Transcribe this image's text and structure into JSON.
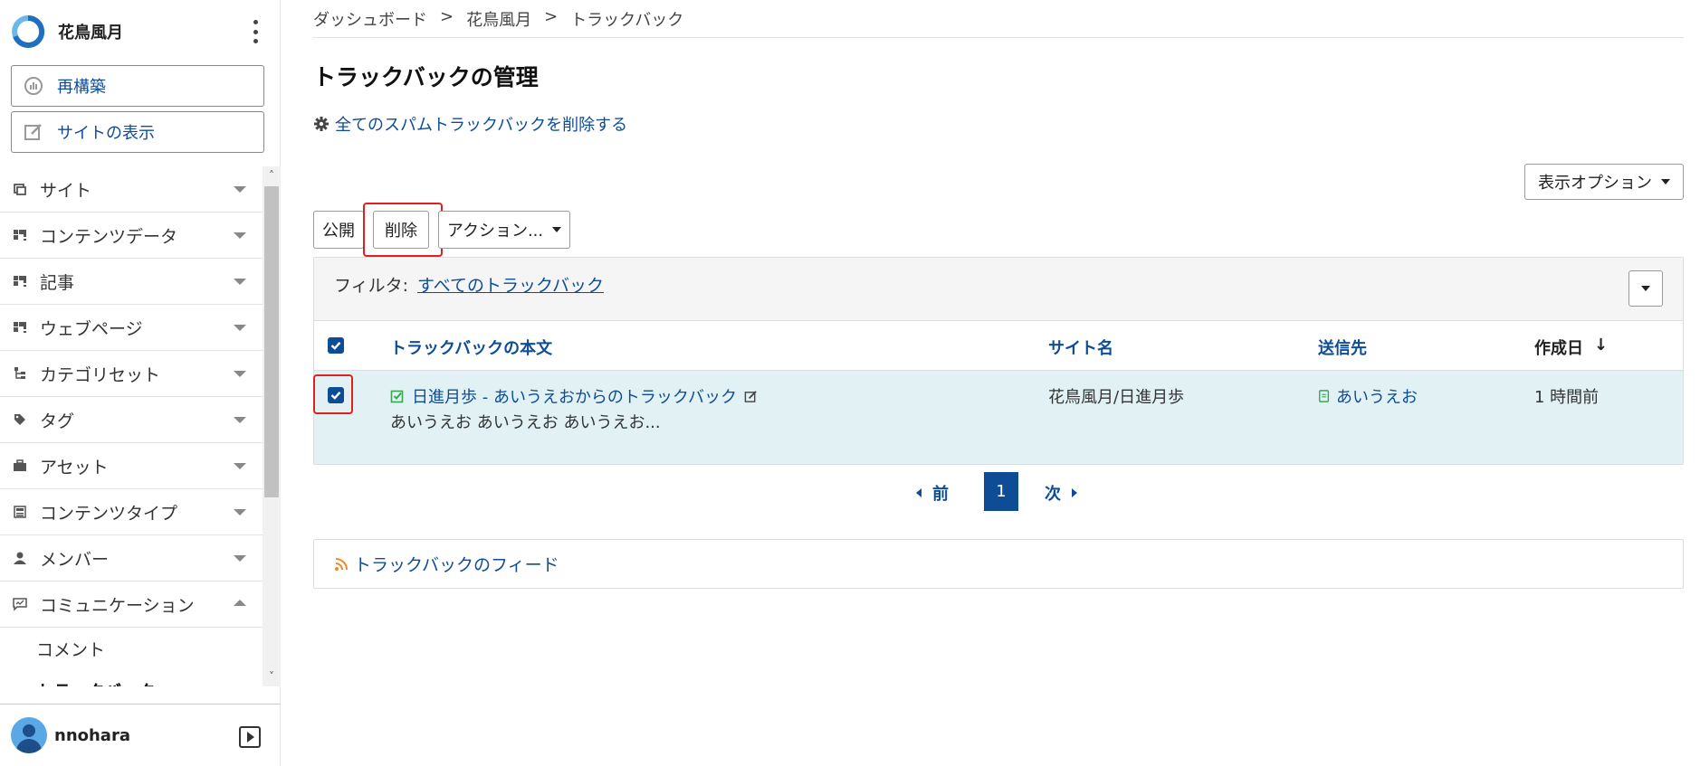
{
  "site": {
    "name": "花鳥風月"
  },
  "sidebar": {
    "buttons": {
      "rebuild": "再構築",
      "view_site": "サイトの表示"
    },
    "menu": [
      {
        "label": "サイト",
        "icon": "site-icon"
      },
      {
        "label": "コンテンツデータ",
        "icon": "content-data-icon"
      },
      {
        "label": "記事",
        "icon": "entry-icon"
      },
      {
        "label": "ウェブページ",
        "icon": "webpage-icon"
      },
      {
        "label": "カテゴリセット",
        "icon": "category-set-icon"
      },
      {
        "label": "タグ",
        "icon": "tag-icon"
      },
      {
        "label": "アセット",
        "icon": "asset-icon"
      },
      {
        "label": "コンテンツタイプ",
        "icon": "content-type-icon"
      },
      {
        "label": "メンバー",
        "icon": "member-icon"
      },
      {
        "label": "コミュニケーション",
        "icon": "communication-icon",
        "expanded": true
      }
    ],
    "submenu": [
      {
        "label": "コメント"
      },
      {
        "label": "トラックバック",
        "active": true
      }
    ],
    "user": {
      "name": "nnohara"
    }
  },
  "breadcrumb": [
    "ダッシュボード",
    "花鳥風月",
    "トラックバック"
  ],
  "breadcrumb_sep": ">",
  "page": {
    "title": "トラックバックの管理",
    "spam_link": "全てのスパムトラックバックを削除する",
    "display_options": "表示オプション"
  },
  "actions": {
    "publish": "公開",
    "delete": "削除",
    "more": "アクション..."
  },
  "filter": {
    "label": "フィルタ:",
    "value": "すべてのトラックバック"
  },
  "table": {
    "headers": {
      "body": "トラックバックの本文",
      "site": "サイト名",
      "target": "送信先",
      "created": "作成日",
      "sort_indicator": "↓"
    },
    "rows": [
      {
        "checked": true,
        "title": "日進月歩 - あいうえおからのトラックバック",
        "excerpt": "あいうえお あいうえお あいうえお...",
        "site": "花鳥風月/日進月歩",
        "target": "あいうえお",
        "created": "1 時間前"
      }
    ]
  },
  "pagination": {
    "prev": "前",
    "current": "1",
    "next": "次"
  },
  "feed": {
    "label": "トラックバックのフィード"
  },
  "colors": {
    "accent": "#0e4d96",
    "row_selected": "#e1f1f4",
    "highlight": "#e02020",
    "feed": "#f08a24",
    "status_green": "#3aa655"
  }
}
